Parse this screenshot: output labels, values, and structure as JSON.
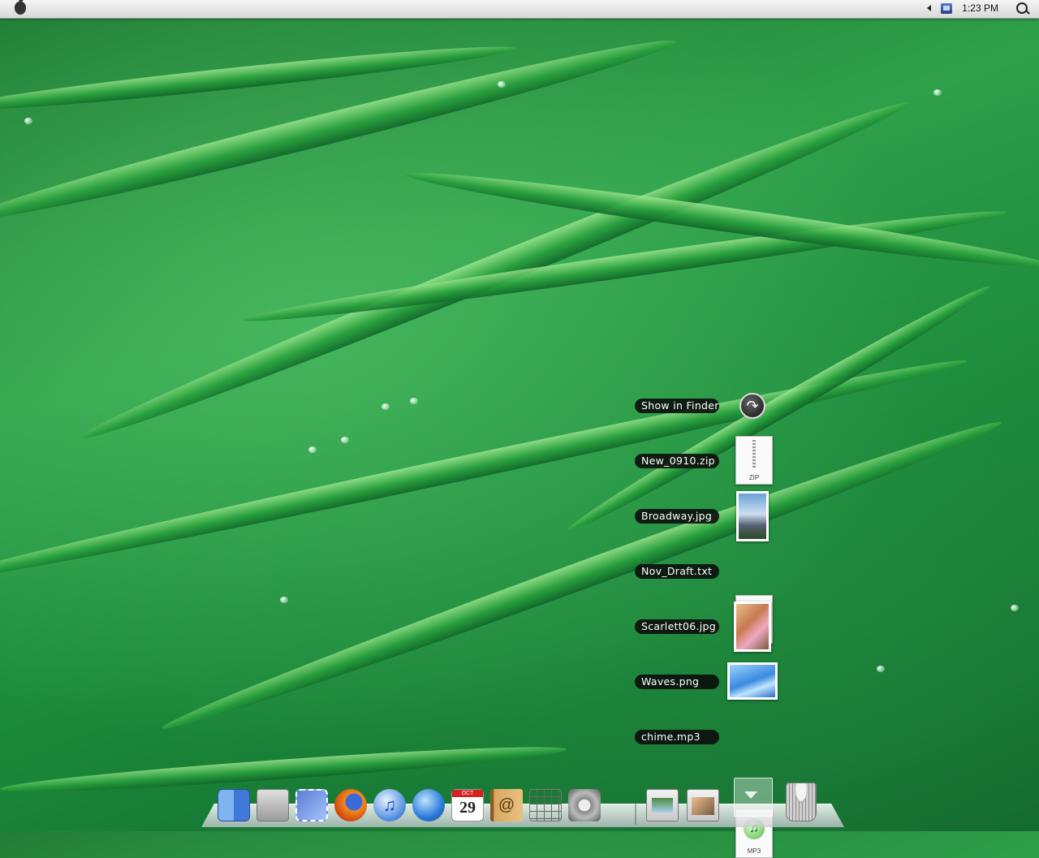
{
  "menubar": {
    "apple_menu": "apple-icon",
    "clock": "1:23 PM",
    "status_icons": [
      "volume-arrow-icon",
      "network-icon",
      "spotlight-icon"
    ]
  },
  "stack_popup": {
    "show_in_finder": "Show in Finder",
    "items": [
      {
        "label": "New_0910.zip",
        "icon": "zip-file-icon",
        "tag": "ZIP"
      },
      {
        "label": "Broadway.jpg",
        "icon": "image-thumbnail-icon"
      },
      {
        "label": "Nov_Draft.txt",
        "icon": "text-document-icon"
      },
      {
        "label": "Scarlett06.jpg",
        "icon": "image-thumbnail-icon"
      },
      {
        "label": "Waves.png",
        "icon": "image-thumbnail-icon"
      },
      {
        "label": "chime.mp3",
        "icon": "mp3-file-icon",
        "tag": "MP3"
      }
    ]
  },
  "dock": {
    "apps": [
      "finder",
      "hard-disk",
      "mail",
      "firefox",
      "itunes",
      "safari",
      "ical",
      "address-book",
      "calculator",
      "system-preferences"
    ],
    "ical": {
      "month": "OCT",
      "day": "29"
    },
    "right_side": [
      "minimized-window-1",
      "minimized-window-2",
      "downloads-stack",
      "trash"
    ]
  }
}
